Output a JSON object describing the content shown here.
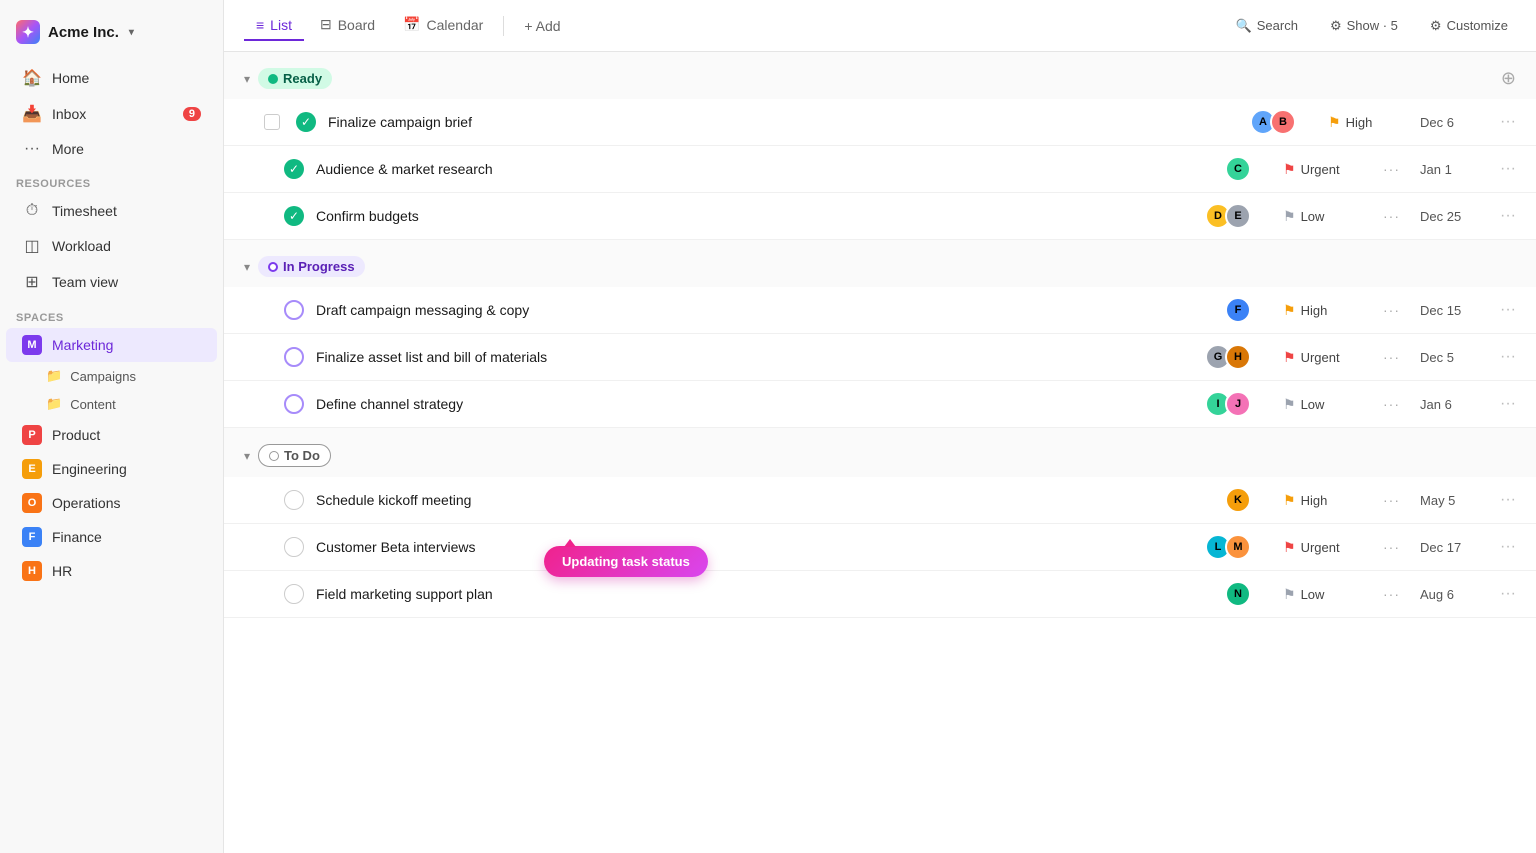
{
  "app": {
    "name": "Acme Inc.",
    "logo_label": "★"
  },
  "nav": {
    "items": [
      {
        "id": "home",
        "label": "Home",
        "icon": "🏠"
      },
      {
        "id": "inbox",
        "label": "Inbox",
        "icon": "📥",
        "badge": "9"
      },
      {
        "id": "more",
        "label": "More",
        "icon": "⋯"
      }
    ]
  },
  "resources": {
    "label": "Resources",
    "items": [
      {
        "id": "timesheet",
        "label": "Timesheet",
        "icon": "⏱"
      },
      {
        "id": "workload",
        "label": "Workload",
        "icon": "📊"
      },
      {
        "id": "teamview",
        "label": "Team view",
        "icon": "⊞"
      }
    ]
  },
  "spaces": {
    "label": "Spaces",
    "items": [
      {
        "id": "marketing",
        "label": "Marketing",
        "color": "#7c3aed",
        "abbr": "M",
        "active": true,
        "children": [
          {
            "id": "campaigns",
            "label": "Campaigns"
          },
          {
            "id": "content",
            "label": "Content"
          }
        ]
      },
      {
        "id": "product",
        "label": "Product",
        "color": "#ef4444",
        "abbr": "P"
      },
      {
        "id": "engineering",
        "label": "Engineering",
        "color": "#f59e0b",
        "abbr": "E"
      },
      {
        "id": "operations",
        "label": "Operations",
        "color": "#f97316",
        "abbr": "O"
      },
      {
        "id": "finance",
        "label": "Finance",
        "color": "#3b82f6",
        "abbr": "F"
      },
      {
        "id": "hr",
        "label": "HR",
        "color": "#f97316",
        "abbr": "H"
      }
    ]
  },
  "tabs": [
    {
      "id": "list",
      "label": "List",
      "icon": "≡",
      "active": true
    },
    {
      "id": "board",
      "label": "Board",
      "icon": "⊟"
    },
    {
      "id": "calendar",
      "label": "Calendar",
      "icon": "📅"
    }
  ],
  "toolbar": {
    "add_label": "+ Add",
    "search_label": "Search",
    "show_label": "Show · 5",
    "customize_label": "Customize"
  },
  "groups": [
    {
      "id": "ready",
      "label": "Ready",
      "type": "ready",
      "tasks": [
        {
          "id": "t1",
          "name": "Finalize campaign brief",
          "status": "done",
          "avatars": [
            "#60a5fa",
            "#f87171"
          ],
          "priority": "High",
          "priority_type": "high",
          "date": "Dec 6",
          "has_checkbox": true
        },
        {
          "id": "t2",
          "name": "Audience & market research",
          "status": "done",
          "avatars": [
            "#34d399"
          ],
          "priority": "Urgent",
          "priority_type": "urgent",
          "date": "Jan 1",
          "has_checkbox": false
        },
        {
          "id": "t3",
          "name": "Confirm budgets",
          "status": "done",
          "avatars": [
            "#fbbf24",
            "#60a5fa"
          ],
          "priority": "Low",
          "priority_type": "low",
          "date": "Dec 25",
          "has_checkbox": false
        }
      ]
    },
    {
      "id": "inprogress",
      "label": "In Progress",
      "type": "inprogress",
      "tasks": [
        {
          "id": "t4",
          "name": "Draft campaign messaging & copy",
          "status": "circle",
          "avatars": [
            "#3b82f6"
          ],
          "priority": "High",
          "priority_type": "high",
          "date": "Dec 15",
          "has_checkbox": false
        },
        {
          "id": "t5",
          "name": "Finalize asset list and bill of materials",
          "status": "circle",
          "avatars": [
            "#9ca3af",
            "#60a5fa"
          ],
          "priority": "Urgent",
          "priority_type": "urgent",
          "date": "Dec 5",
          "has_checkbox": false
        },
        {
          "id": "t6",
          "name": "Define channel strategy",
          "status": "circle",
          "avatars": [
            "#34d399",
            "#f472b6"
          ],
          "priority": "Low",
          "priority_type": "low",
          "date": "Jan 6",
          "has_checkbox": false,
          "has_tooltip": true,
          "tooltip_text": "Updating task status"
        }
      ]
    },
    {
      "id": "todo",
      "label": "To Do",
      "type": "todo",
      "tasks": [
        {
          "id": "t7",
          "name": "Schedule kickoff meeting",
          "status": "empty",
          "avatars": [
            "#f59e0b"
          ],
          "priority": "High",
          "priority_type": "high",
          "date": "May 5",
          "has_checkbox": false
        },
        {
          "id": "t8",
          "name": "Customer Beta interviews",
          "status": "empty",
          "avatars": [
            "#06b6d4",
            "#fb923c"
          ],
          "priority": "Urgent",
          "priority_type": "urgent",
          "date": "Dec 17",
          "has_checkbox": false
        },
        {
          "id": "t9",
          "name": "Field marketing support plan",
          "status": "empty",
          "avatars": [
            "#10b981"
          ],
          "priority": "Low",
          "priority_type": "low",
          "date": "Aug 6",
          "has_checkbox": false
        }
      ]
    }
  ],
  "avatar_colors": {
    "t1": [
      "#60a5fa",
      "#f87171"
    ],
    "t2": [
      "#34d399"
    ],
    "t3": [
      "#fbbf24",
      "#60a5fa"
    ],
    "t4": [
      "#3b82f6"
    ],
    "t5": [
      "#9ca3af",
      "#d97706"
    ],
    "t6": [
      "#34d399",
      "#f472b6"
    ],
    "t7": [
      "#f59e0b"
    ],
    "t8": [
      "#06b6d4",
      "#fb923c"
    ],
    "t9": [
      "#10b981"
    ]
  }
}
